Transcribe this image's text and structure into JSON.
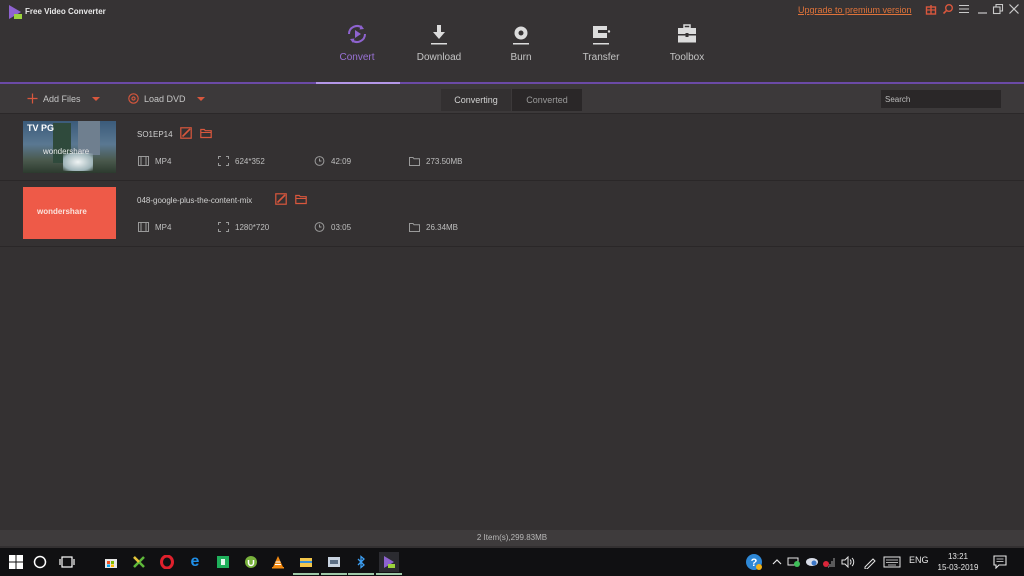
{
  "app": {
    "title": "Free Video Converter",
    "upgrade_link": "Upgrade to premium version",
    "accent_color": "#8e63cf",
    "icon_color": "#d9573d"
  },
  "titlebar_icons": [
    "gift-icon",
    "search-icon",
    "menu-icon",
    "minimize-icon",
    "restore-icon",
    "close-icon"
  ],
  "nav": [
    {
      "label": "Convert",
      "icon": "convert-icon",
      "active": true
    },
    {
      "label": "Download",
      "icon": "download-icon",
      "active": false
    },
    {
      "label": "Burn",
      "icon": "burn-icon",
      "active": false
    },
    {
      "label": "Transfer",
      "icon": "transfer-icon",
      "active": false
    },
    {
      "label": "Toolbox",
      "icon": "toolbox-icon",
      "active": false
    }
  ],
  "toolbar": {
    "add_files": "Add Files",
    "load_dvd": "Load DVD",
    "tabs": [
      {
        "label": "Converting",
        "active": true
      },
      {
        "label": "Converted",
        "active": false
      }
    ],
    "search_placeholder": "Search"
  },
  "files": [
    {
      "name": "SO1EP14",
      "format": "MP4",
      "resolution": "624*352",
      "duration": "42:09",
      "size": "273.50MB",
      "thumb_badge": "TV PG",
      "thumb_brand": "wondershare"
    },
    {
      "name": "048-google-plus-the-content-mix",
      "format": "MP4",
      "resolution": "1280*720",
      "duration": "03:05",
      "size": "26.34MB",
      "thumb_brand": "wondershare"
    }
  ],
  "status": {
    "summary": "2 Item(s),299.83MB"
  },
  "taskbar": {
    "apps": [
      "start-icon",
      "cortana-icon",
      "task-view-icon",
      "store-icon",
      "xmind-icon",
      "opera-icon",
      "edge-icon",
      "app-green-icon",
      "utorrent-icon",
      "vlc-icon",
      "file-explorer-icon",
      "app-box-icon",
      "bluetooth-app-icon",
      "video-converter-icon"
    ],
    "tray": {
      "language": "ENG",
      "time": "13:21",
      "date": "15-03-2019"
    }
  }
}
